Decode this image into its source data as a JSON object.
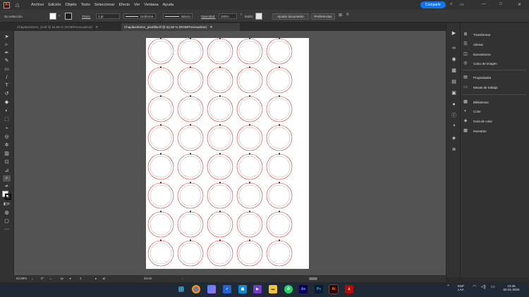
{
  "menubar": {
    "app_logo": "Ai",
    "items": [
      "Archivo",
      "Edición",
      "Objeto",
      "Texto",
      "Seleccionar",
      "Efecto",
      "Ver",
      "Ventana",
      "Ayuda"
    ],
    "share_label": "Compartir"
  },
  "controlbar": {
    "selection_text": "No selección",
    "stroke_label": "Trazo:",
    "stroke_value": "1 pt",
    "profile_value": "Uniforme",
    "brush_value": "Básico",
    "opacity_label": "Opacidad:",
    "opacity_value": "100%",
    "style_label": "Estilo:",
    "align_doc_label": "Ajustar documento",
    "preferences_label": "Preferencias"
  },
  "tabs": [
    {
      "label": "Chapitas25mm_13.tif @ 52,55 % (RGB/Previsualizar)",
      "active": false
    },
    {
      "label": "Chapitas25mm_plantilla.tif @ 52,55 % (RGB/Previsualizar)",
      "active": true
    }
  ],
  "panel": {
    "groups": [
      [
        "Transformar",
        "Alinear",
        "Buscatrazos",
        "Calco de imagen"
      ],
      [
        "Propiedades",
        "Mesas de trabajo"
      ],
      [
        "Bibliotecas",
        "Color",
        "Guía de color",
        "Muestras"
      ]
    ]
  },
  "statusbar": {
    "zoom": "52,59%",
    "rotation": "0°",
    "artboard_number": "1",
    "tool_label": "Zoom"
  },
  "artboard": {
    "rows": 8,
    "cols": 5,
    "circle_color": "#cc3b3b",
    "inner_color": "#9a9a9a"
  },
  "taskbar": {
    "apps": [
      "windows",
      "chrome",
      "photos",
      "todo",
      "files",
      "power-automate",
      "explorer",
      "whatsapp",
      "after-effects",
      "photoshop",
      "illustrator",
      "acrobat"
    ],
    "lang_top": "ESP",
    "lang_bottom": "LAA",
    "time": "10:26",
    "date": "02-01-2025"
  }
}
